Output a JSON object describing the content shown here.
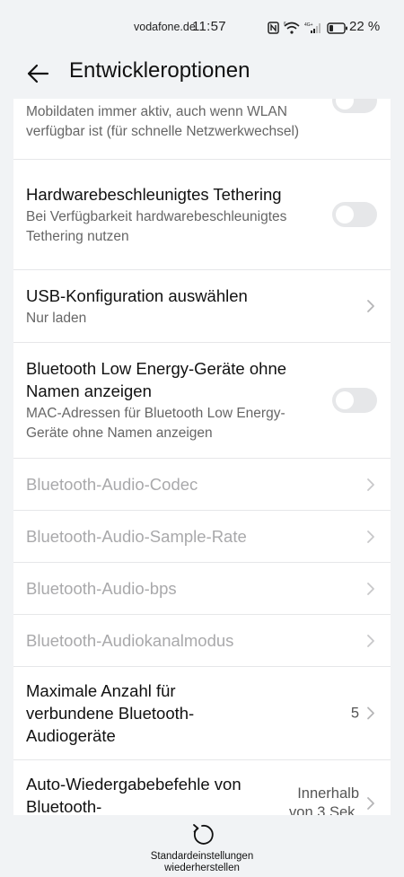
{
  "status_bar": {
    "carrier": "vodafone.de",
    "time": "11:57",
    "battery_percent": "22 %",
    "battery_level": 0.22,
    "icons": [
      "nfc-icon",
      "wifi-icon",
      "signal-icon",
      "battery-icon"
    ]
  },
  "header": {
    "title": "Entwickleroptionen",
    "back_icon": "arrow-left-icon"
  },
  "settings": {
    "mobile_data": {
      "subtitle": "Mobildaten immer aktiv, auch wenn WLAN verfügbar ist (für schnelle Netzwerkwechsel)",
      "enabled": false
    },
    "tethering": {
      "title": "Hardwarebeschleunigtes Tethering",
      "subtitle": "Bei Verfügbarkeit hardwarebeschleunigtes Tethering nutzen",
      "enabled": false
    },
    "usb_config": {
      "title": "USB-Konfiguration auswählen",
      "subtitle": "Nur laden"
    },
    "ble_devices": {
      "title": "Bluetooth Low Energy-Geräte ohne Namen anzeigen",
      "subtitle": "MAC-Adressen für Bluetooth Low Energy-Geräte ohne Namen anzeigen",
      "enabled": false
    },
    "bt_codec": {
      "title": "Bluetooth-Audio-Codec"
    },
    "bt_sample_rate": {
      "title": "Bluetooth-Audio-Sample-Rate"
    },
    "bt_bps": {
      "title": "Bluetooth-Audio-bps"
    },
    "bt_channel_mode": {
      "title": "Bluetooth-Audiokanalmodus"
    },
    "max_devices": {
      "title": "Maximale Anzahl für verbundene Bluetooth-Audiogeräte",
      "value": "5"
    },
    "auto_playback": {
      "title": "Auto-Wiedergabebefehle von Bluetooth-",
      "value": "Innerhalb von 3 Sek."
    }
  },
  "footer": {
    "reset_label": "Standardeinstellungen wiederherstellen",
    "reset_icon": "reset-icon"
  },
  "colors": {
    "background": "#f1f3f5",
    "card": "#ffffff",
    "toggle_off": "#e6e7e9",
    "disabled_text": "#a9a9ab"
  }
}
